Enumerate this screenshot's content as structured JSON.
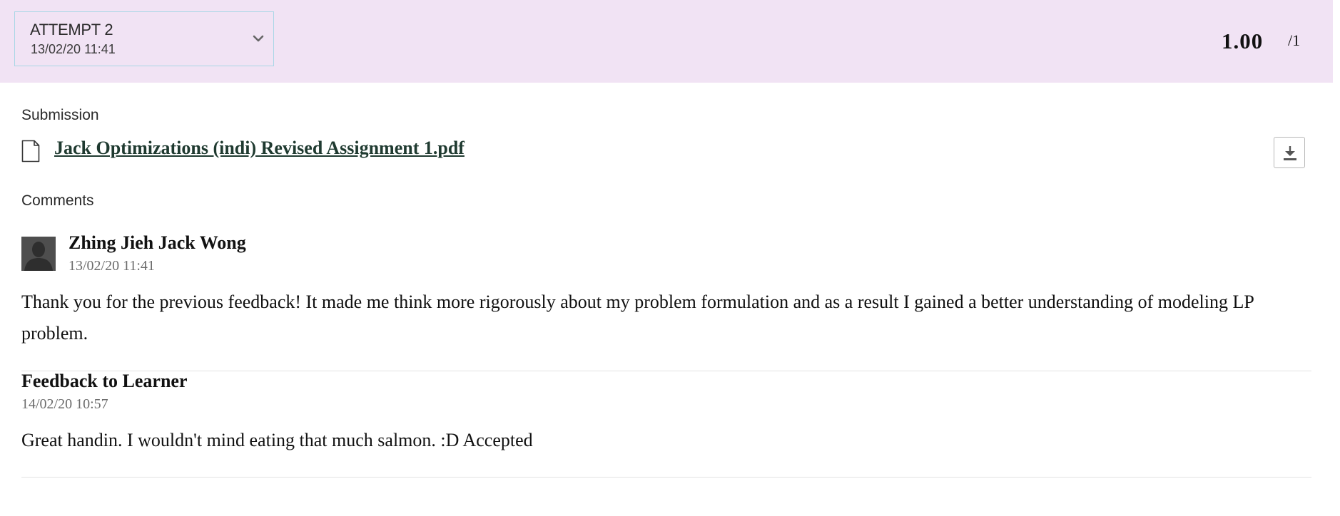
{
  "attempt": {
    "label": "ATTEMPT 2",
    "date": "13/02/20 11:41"
  },
  "grade": {
    "score": "1.00",
    "max": "/1"
  },
  "submission": {
    "heading": "Submission",
    "file_name": "Jack Optimizations (indi) Revised Assignment 1.pdf"
  },
  "comments": {
    "heading": "Comments",
    "author": "Zhing Jieh Jack Wong",
    "timestamp": "13/02/20 11:41",
    "text": "Thank you for the previous feedback! It made me think more rigorously about my problem formulation and as a result I gained a better understanding of modeling LP problem."
  },
  "feedback": {
    "heading": "Feedback to Learner",
    "timestamp": "14/02/20 10:57",
    "text": "Great handin. I wouldn't mind eating that much salmon. :D Accepted"
  },
  "colors": {
    "header_bg": "#f1e3f4",
    "select_border": "#a9d7e6",
    "link": "#1f3a30"
  }
}
